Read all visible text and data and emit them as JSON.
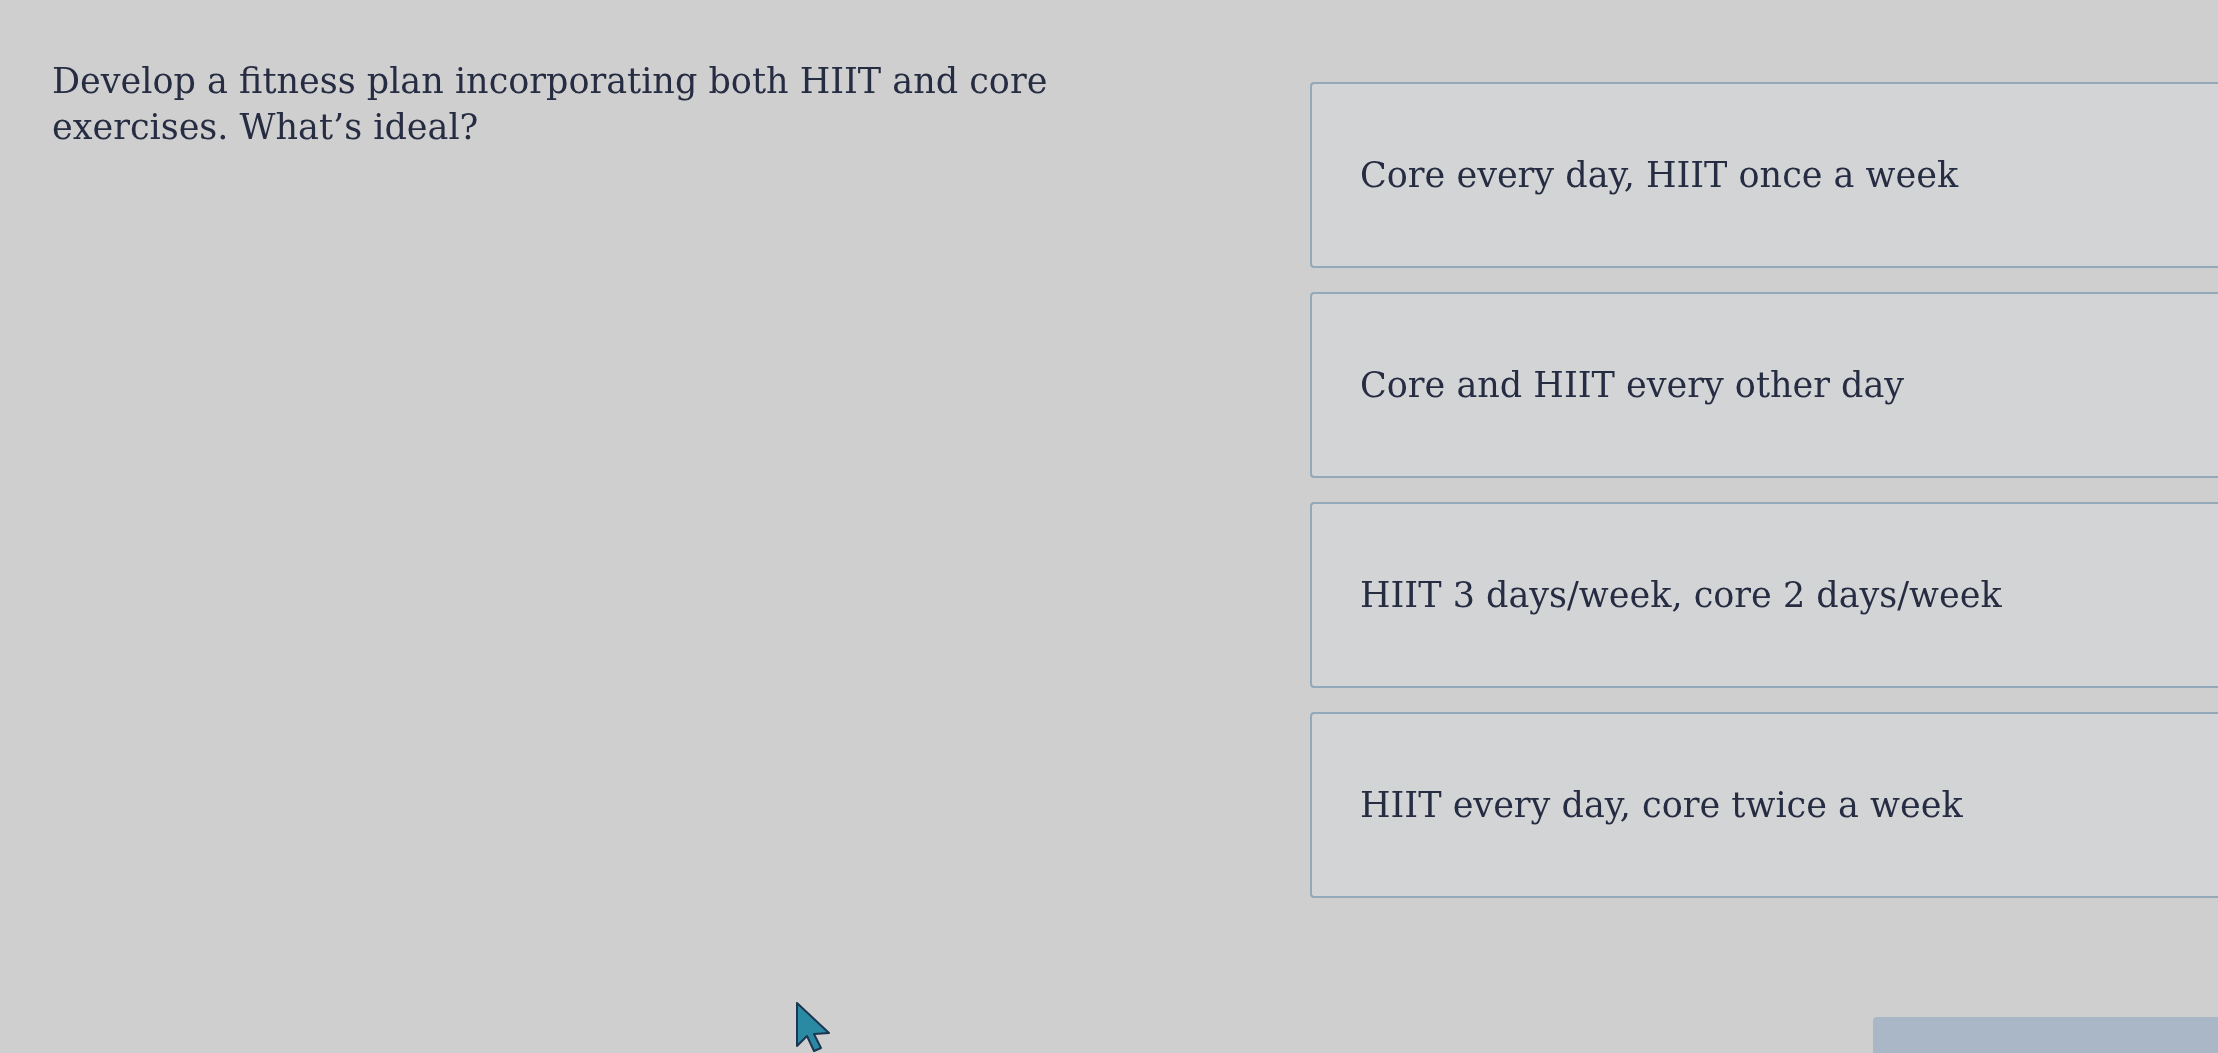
{
  "question": {
    "text": "Develop a fitness plan incorporating both HIIT and core exercises. What’s ideal?"
  },
  "options": [
    {
      "label": "Core every day, HIIT once a week",
      "selected": false
    },
    {
      "label": "Core and HIIT every other day",
      "selected": false
    },
    {
      "label": "HIIT 3 days/week, core 2 days/week",
      "selected": false
    },
    {
      "label": "HIIT every day, core twice a week",
      "selected": false
    }
  ]
}
